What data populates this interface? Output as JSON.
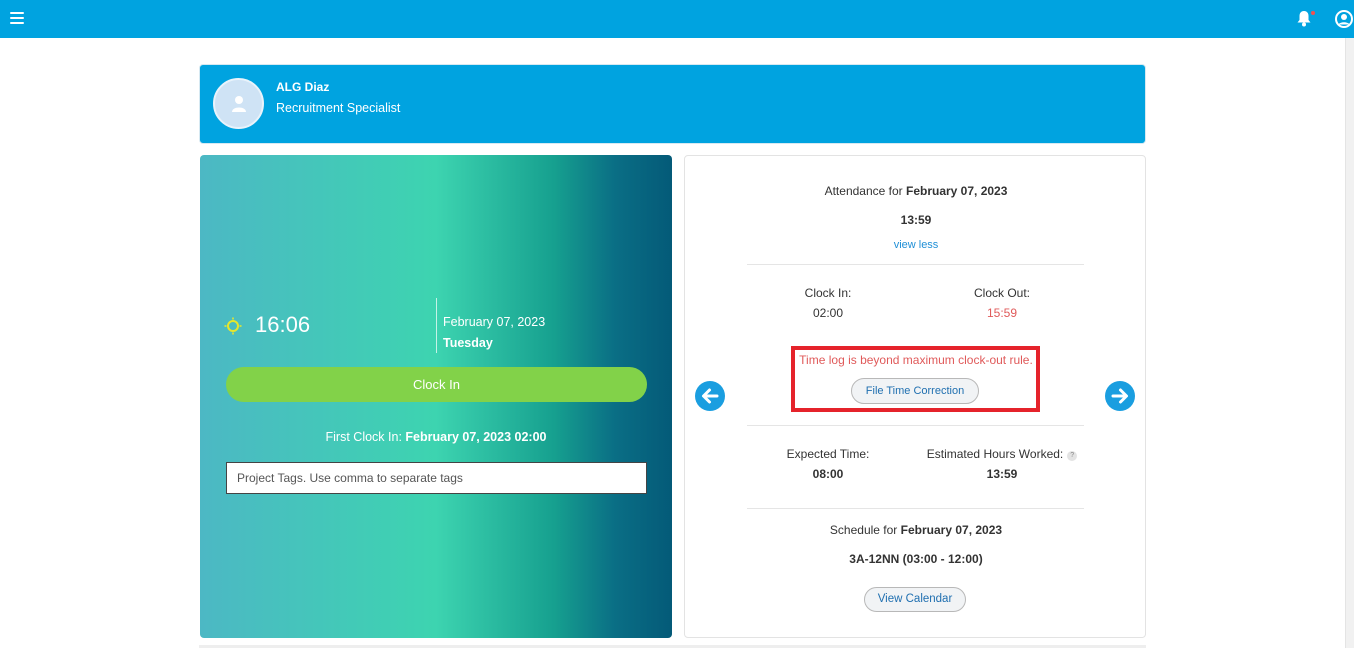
{
  "profile": {
    "name": "ALG Diaz",
    "role": "Recruitment Specialist"
  },
  "clock": {
    "time": "16:06",
    "date": "February 07, 2023",
    "day": "Tuesday",
    "button_label": "Clock In",
    "first_in_label": "First Clock In:",
    "first_in_value": "February 07, 2023 02:00",
    "tags_placeholder": "Project Tags. Use comma to separate tags"
  },
  "attendance": {
    "title_prefix": "Attendance for",
    "title_date": "February 07, 2023",
    "total": "13:59",
    "view_less": "view less",
    "clock_in_label": "Clock In:",
    "clock_in_value": "02:00",
    "clock_out_label": "Clock Out:",
    "clock_out_value": "15:59",
    "warning": "Time log is beyond maximum clock-out rule.",
    "correction_button": "File Time Correction",
    "expected_label": "Expected Time:",
    "expected_value": "08:00",
    "estimated_label": "Estimated Hours Worked:",
    "estimated_value": "13:59",
    "help_mark": "?",
    "schedule_prefix": "Schedule for",
    "schedule_date": "February 07, 2023",
    "schedule_value": "3A-12NN (03:00 - 12:00)",
    "view_calendar": "View Calendar"
  },
  "icons": {
    "menu": "hamburger-icon",
    "notifications": "bell-icon",
    "account": "user-circle-icon",
    "previous": "arrow-left-circle-icon",
    "next": "arrow-right-circle-icon",
    "daytime": "sun-icon"
  },
  "colors": {
    "header": "#00a3e0",
    "clock_button": "#82d249",
    "warning_text": "#e05a5a",
    "warning_border": "#e5232b",
    "arrow": "#1a9ee0"
  }
}
